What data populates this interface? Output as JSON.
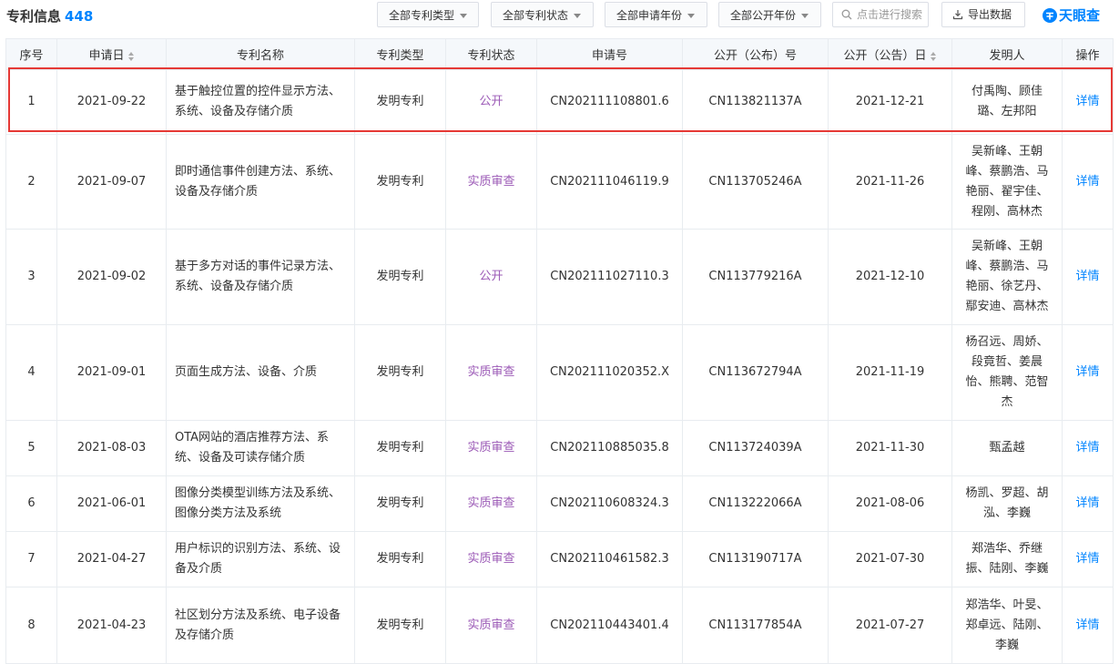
{
  "header": {
    "title": "专利信息",
    "count": "448",
    "filters": [
      "全部专利类型",
      "全部专利状态",
      "全部申请年份",
      "全部公开年份"
    ],
    "search_placeholder": "点击进行搜索",
    "export_label": "导出数据",
    "brand": "天眼查"
  },
  "table": {
    "columns": [
      "序号",
      "申请日",
      "专利名称",
      "专利类型",
      "专利状态",
      "申请号",
      "公开（公布）号",
      "公开（公告）日",
      "发明人",
      "操作"
    ],
    "rows": [
      {
        "no": "1",
        "apply_date": "2021-09-22",
        "name": "基于触控位置的控件显示方法、系统、设备及存储介质",
        "type": "发明专利",
        "status": "公开",
        "apply_no": "CN202111108801.6",
        "pub_no": "CN113821137A",
        "pub_date": "2021-12-21",
        "inventors": "付禹陶、顾佳璐、左邦阳",
        "action": "详情"
      },
      {
        "no": "2",
        "apply_date": "2021-09-07",
        "name": "即时通信事件创建方法、系统、设备及存储介质",
        "type": "发明专利",
        "status": "实质审查",
        "apply_no": "CN202111046119.9",
        "pub_no": "CN113705246A",
        "pub_date": "2021-11-26",
        "inventors": "吴新峰、王朝峰、蔡鹏浩、马艳丽、翟宇佳、程刚、高林杰",
        "action": "详情"
      },
      {
        "no": "3",
        "apply_date": "2021-09-02",
        "name": "基于多方对话的事件记录方法、系统、设备及存储介质",
        "type": "发明专利",
        "status": "公开",
        "apply_no": "CN202111027110.3",
        "pub_no": "CN113779216A",
        "pub_date": "2021-12-10",
        "inventors": "吴新峰、王朝峰、蔡鹏浩、马艳丽、徐艺丹、鄢安迪、高林杰",
        "action": "详情"
      },
      {
        "no": "4",
        "apply_date": "2021-09-01",
        "name": "页面生成方法、设备、介质",
        "type": "发明专利",
        "status": "实质审查",
        "apply_no": "CN202111020352.X",
        "pub_no": "CN113672794A",
        "pub_date": "2021-11-19",
        "inventors": "杨召远、周娇、段竟哲、姜晨怡、熊聘、范智杰",
        "action": "详情"
      },
      {
        "no": "5",
        "apply_date": "2021-08-03",
        "name": "OTA网站的酒店推荐方法、系统、设备及可读存储介质",
        "type": "发明专利",
        "status": "实质审查",
        "apply_no": "CN202110885035.8",
        "pub_no": "CN113724039A",
        "pub_date": "2021-11-30",
        "inventors": "甄孟越",
        "action": "详情"
      },
      {
        "no": "6",
        "apply_date": "2021-06-01",
        "name": "图像分类模型训练方法及系统、图像分类方法及系统",
        "type": "发明专利",
        "status": "实质审查",
        "apply_no": "CN202110608324.3",
        "pub_no": "CN113222066A",
        "pub_date": "2021-08-06",
        "inventors": "杨凯、罗超、胡泓、李巍",
        "action": "详情"
      },
      {
        "no": "7",
        "apply_date": "2021-04-27",
        "name": "用户标识的识别方法、系统、设备及介质",
        "type": "发明专利",
        "status": "实质审查",
        "apply_no": "CN202110461582.3",
        "pub_no": "CN113190717A",
        "pub_date": "2021-07-30",
        "inventors": "郑浩华、乔继振、陆刚、李巍",
        "action": "详情"
      },
      {
        "no": "8",
        "apply_date": "2021-04-23",
        "name": "社区划分方法及系统、电子设备及存储介质",
        "type": "发明专利",
        "status": "实质审查",
        "apply_no": "CN202110443401.4",
        "pub_no": "CN113177854A",
        "pub_date": "2021-07-27",
        "inventors": "郑浩华、叶旻、郑卓远、陆刚、李巍",
        "action": "详情"
      }
    ]
  },
  "colors": {
    "accent": "#0084ff",
    "status": "#9b59b6",
    "highlight": "#e53935",
    "header_bg": "#f5f8fb"
  }
}
